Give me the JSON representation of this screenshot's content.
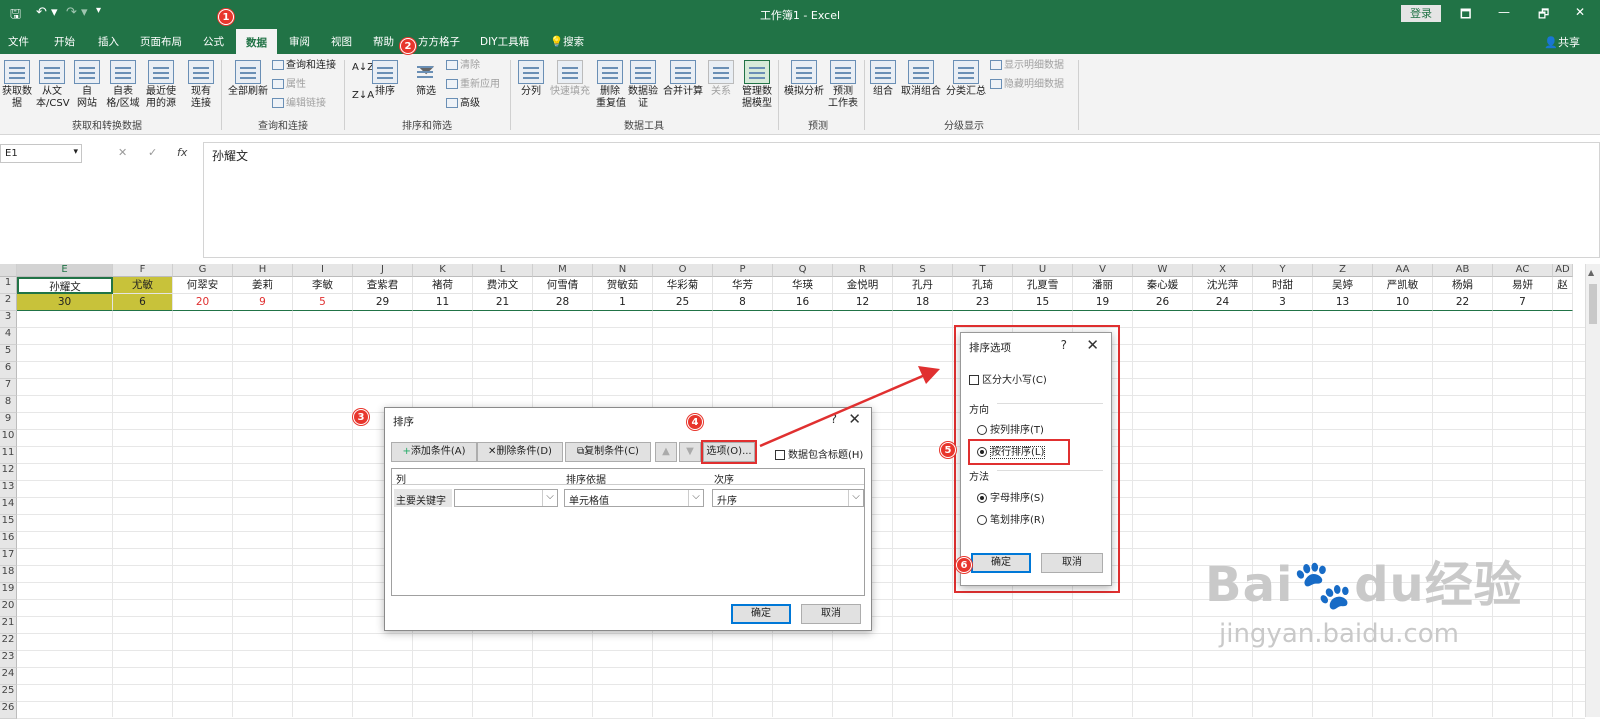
{
  "titlebar": {
    "title": "工作簿1  -  Excel",
    "save": "🖫",
    "undo": "↶ ▾",
    "redo": "↷ ▾",
    "more": "▾",
    "login": "登录",
    "ribbon_opts": "🗖",
    "min": "—",
    "restore": "🗗",
    "close": "✕"
  },
  "tabs": [
    "文件",
    "开始",
    "插入",
    "页面布局",
    "公式",
    "数据",
    "审阅",
    "视图",
    "帮助",
    "方方格子",
    "DIY工具箱",
    "搜索"
  ],
  "share": "共享",
  "ribbon": {
    "get_data": "获取数\n据",
    "from_csv": "从文\n本/CSV",
    "from_web": "自\n网站",
    "from_table": "自表\n格/区域",
    "recent": "最近使\n用的源",
    "existing": "现有\n连接",
    "group1": "获取和转换数据",
    "refresh_all": "全部刷新",
    "queries": "查询和连接",
    "properties": "属性",
    "edit_links": "编辑链接",
    "group2": "查询和连接",
    "sort_az": "A↓Z",
    "sort_za": "Z↓A",
    "sort": "排序",
    "filter": "筛选",
    "clear": "清除",
    "reapply": "重新应用",
    "advanced": "高级",
    "group3": "排序和筛选",
    "text_to_col": "分列",
    "flash_fill": "快速填充",
    "remove_dup": "删除\n重复值",
    "validation": "数据验\n证",
    "consolidate": "合并计算",
    "relationships": "关系",
    "manage_model": "管理数\n据模型",
    "group4": "数据工具",
    "whatif": "模拟分析",
    "forecast": "预测\n工作表",
    "group5": "预测",
    "group_btn": "组合",
    "ungroup": "取消组合",
    "subtotal": "分类汇总",
    "show_detail": "显示明细数据",
    "hide_detail": "隐藏明细数据",
    "group6": "分级显示"
  },
  "formula_bar": {
    "name_box": "E1",
    "cancel": "✕",
    "enter": "✓",
    "fx": "fx",
    "content": "孙耀文"
  },
  "columns": [
    "E",
    "F",
    "G",
    "H",
    "I",
    "J",
    "K",
    "L",
    "M",
    "N",
    "O",
    "P",
    "Q",
    "R",
    "S",
    "T",
    "U",
    "V",
    "W",
    "X",
    "Y",
    "Z",
    "AA",
    "AB",
    "AC",
    "AD"
  ],
  "row1": [
    "孙耀文",
    "尤敏",
    "何翠安",
    "姜莉",
    "李敏",
    "查紫君",
    "褚荷",
    "费沛文",
    "何雪倩",
    "贺敏茹",
    "华彩菊",
    "华芳",
    "华瑛",
    "金悦明",
    "孔丹",
    "孔琦",
    "孔夏雪",
    "潘丽",
    "秦心媛",
    "沈光萍",
    "时甜",
    "吴婷",
    "严凯敏",
    "杨娟",
    "易妍",
    "赵"
  ],
  "row2": [
    "30",
    "6",
    "20",
    "9",
    "5",
    "29",
    "11",
    "21",
    "28",
    "1",
    "25",
    "8",
    "16",
    "12",
    "18",
    "23",
    "15",
    "19",
    "26",
    "24",
    "3",
    "13",
    "10",
    "22",
    "7",
    ""
  ],
  "row_numbers": [
    "1",
    "2",
    "3",
    "4",
    "5",
    "6",
    "7",
    "8",
    "9",
    "10",
    "11",
    "12",
    "13",
    "14",
    "15",
    "16",
    "17",
    "18",
    "19",
    "20",
    "21",
    "22",
    "23",
    "24",
    "25",
    "26"
  ],
  "colors": {
    "accent": "#217346",
    "selected_cell": "#c8c23a",
    "red_value": "#e03030",
    "annotation": "#e03030"
  },
  "sort_dialog": {
    "title": "排序",
    "help": "?",
    "close": "✕",
    "add": "添加条件(A)",
    "delete": "删除条件(D)",
    "copy": "复制条件(C)",
    "up": "▲",
    "down": "▼",
    "options": "选项(O)...",
    "has_header": "数据包含标题(H)",
    "col_header": "列",
    "basis_header": "排序依据",
    "order_header": "次序",
    "primary_key": "主要关键字",
    "key_value": "",
    "basis_value": "单元格值",
    "order_value": "升序",
    "ok": "确定",
    "cancel": "取消"
  },
  "options_dialog": {
    "title": "排序选项",
    "help": "?",
    "close": "✕",
    "case": "区分大小写(C)",
    "direction": "方向",
    "by_col": "按列排序(T)",
    "by_row": "按行排序(L)",
    "method": "方法",
    "alpha": "字母排序(S)",
    "stroke": "笔划排序(R)",
    "ok": "确定",
    "cancel": "取消"
  },
  "annotations": [
    "1",
    "2",
    "3",
    "4",
    "5",
    "6"
  ],
  "watermark": {
    "logo": "Bai🐾du经验",
    "url": "jingyan.baidu.com"
  }
}
